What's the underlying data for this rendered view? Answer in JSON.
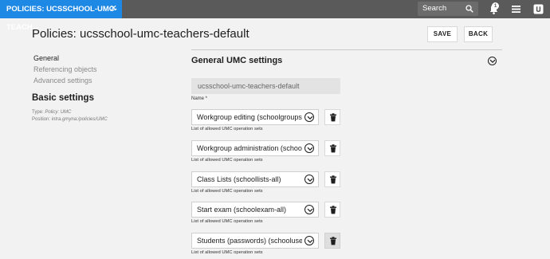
{
  "topbar": {
    "tab_label": "POLICIES: UCSSCHOOL-UMC-TEACH...",
    "tab_close": "✕",
    "search_label": "Search",
    "notification_count": "1"
  },
  "header": {
    "title": "Policies: ucsschool-umc-teachers-default",
    "save_label": "SAVE",
    "back_label": "BACK"
  },
  "nav": {
    "items": [
      {
        "label": "General"
      },
      {
        "label": "Referencing objects"
      },
      {
        "label": "Advanced settings"
      }
    ],
    "section_title": "Basic settings",
    "type_key": "Type:",
    "type_value": "Policy: UMC",
    "position_key": "Position:",
    "position_value": "intra.gmyna:/policies/UMC"
  },
  "content": {
    "title": "General UMC settings",
    "name_value": "ucsschool-umc-teachers-default",
    "name_label": "Name *",
    "operation_sets": [
      {
        "value": "Workgroup editing (schoolgroups-...",
        "help": "List of allowed UMC operation sets"
      },
      {
        "value": "Workgroup administration (school...",
        "help": "List of allowed UMC operation sets"
      },
      {
        "value": "Class Lists (schoollists-all)",
        "help": "List of allowed UMC operation sets"
      },
      {
        "value": "Start exam (schoolexam-all)",
        "help": "List of allowed UMC operation sets"
      },
      {
        "value": "Students (passwords) (schooluser...",
        "help": "List of allowed UMC operation sets"
      }
    ]
  }
}
